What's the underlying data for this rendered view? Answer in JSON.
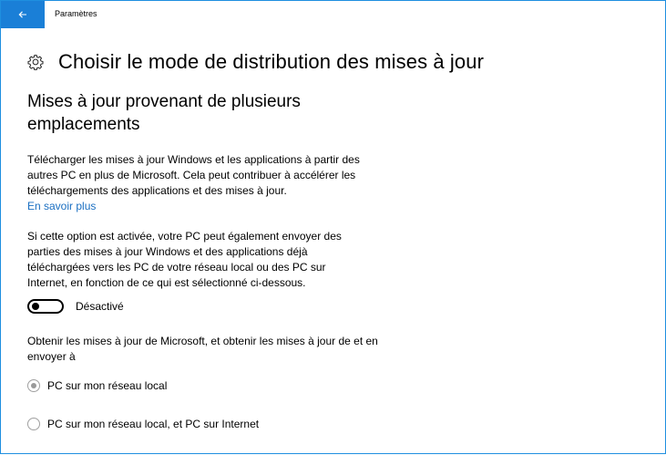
{
  "titlebar": {
    "back_icon": "arrow-left-icon",
    "app_title": "Paramètres",
    "accent_color": "#1a7fd7"
  },
  "header": {
    "icon": "gear-icon",
    "title": "Choisir le mode de distribution des mises à jour"
  },
  "section": {
    "title": "Mises à jour provenant de plusieurs emplacements"
  },
  "intro": {
    "text": "Télécharger les mises à jour Windows et les applications à partir des autres PC en plus de Microsoft. Cela peut contribuer à accélérer les téléchargements des applications et des mises à jour.",
    "link": "En savoir plus"
  },
  "explanation": {
    "text": "Si cette option est activée, votre PC peut également envoyer des parties des mises à jour Windows et des applications déjà téléchargées vers les PC de votre réseau local ou des PC sur Internet, en fonction de ce qui est sélectionné ci-dessous."
  },
  "toggle": {
    "state": "off",
    "label": "Désactivé"
  },
  "options": {
    "prompt": "Obtenir les mises à jour de Microsoft, et obtenir les mises à jour de et en envoyer à",
    "items": [
      {
        "label": "PC sur mon réseau local",
        "selected": true,
        "enabled": false
      },
      {
        "label": "PC sur mon réseau local, et PC sur Internet",
        "selected": false,
        "enabled": false
      }
    ]
  }
}
